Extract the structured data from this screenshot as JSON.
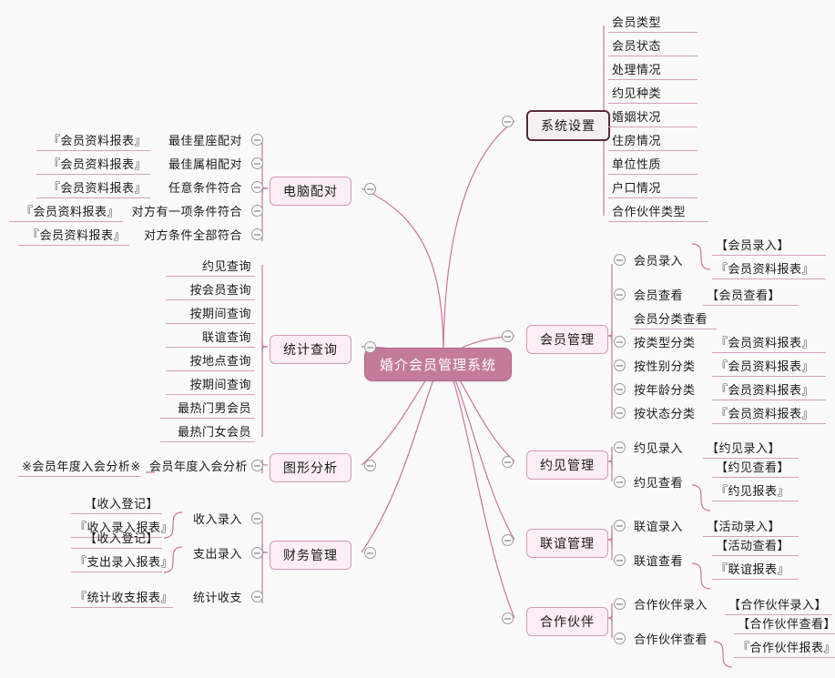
{
  "meta": {
    "title": "婚介会员管理系统",
    "colors": {
      "background": "#fafafa",
      "root_fill": "#c47a9b",
      "root_text": "#ffffff",
      "branch_fill": "#fbeef4",
      "branch_border": "#d49ab8",
      "selected_border": "#5b2639",
      "link": "#c9749b",
      "underline": "#d6a0bd",
      "toggle_stroke": "#9a9a9a"
    },
    "toggle_icon": "collapse-minus-circle-icon"
  },
  "root": {
    "label": "婚介会员管理系统"
  },
  "branches": {
    "system_settings": {
      "label": "系统设置",
      "selected": true,
      "items": [
        "会员类型",
        "会员状态",
        "处理情况",
        "约见种类",
        "婚姻状况",
        "住房情况",
        "单位性质",
        "户口情况",
        "合作伙伴类型"
      ]
    },
    "member_management": {
      "label": "会员管理",
      "items": [
        {
          "label": "会员录入",
          "children": [
            "【会员录入】",
            "『会员资料报表』"
          ]
        },
        {
          "label": "会员查看",
          "children": [
            "【会员查看】"
          ]
        },
        {
          "label": "会员分类查看",
          "children": []
        },
        {
          "label": "按类型分类",
          "children": [
            "『会员资料报表』"
          ]
        },
        {
          "label": "按性别分类",
          "children": [
            "『会员资料报表』"
          ]
        },
        {
          "label": "按年龄分类",
          "children": [
            "『会员资料报表』"
          ]
        },
        {
          "label": "按状态分类",
          "children": [
            "『会员资料报表』"
          ]
        }
      ]
    },
    "appointment_management": {
      "label": "约见管理",
      "items": [
        {
          "label": "约见录入",
          "children": [
            "【约见录入】"
          ]
        },
        {
          "label": "约见查看",
          "children": [
            "【约见查看】",
            "『约见报表』"
          ]
        }
      ]
    },
    "social_management": {
      "label": "联谊管理",
      "items": [
        {
          "label": "联谊录入",
          "children": [
            "【活动录入】"
          ]
        },
        {
          "label": "联谊查看",
          "children": [
            "【活动查看】",
            "『联谊报表』"
          ]
        }
      ]
    },
    "partner_management": {
      "label": "合作伙伴",
      "items": [
        {
          "label": "合作伙伴录入",
          "children": [
            "【合作伙伴录入】"
          ]
        },
        {
          "label": "合作伙伴查看",
          "children": [
            "【合作伙伴查看】",
            "『合作伙伴报表』"
          ]
        }
      ]
    },
    "computer_matching": {
      "label": "电脑配对",
      "items": [
        {
          "label": "最佳星座配对",
          "children": [
            "『会员资料报表』"
          ]
        },
        {
          "label": "最佳属相配对",
          "children": [
            "『会员资料报表』"
          ]
        },
        {
          "label": "任意条件符合",
          "children": [
            "『会员资料报表』"
          ]
        },
        {
          "label": "对方有一项条件符合",
          "children": [
            "『会员资料报表』"
          ]
        },
        {
          "label": "对方条件全部符合",
          "children": [
            "『会员资料报表』"
          ]
        }
      ]
    },
    "statistics_query": {
      "label": "统计查询",
      "items": [
        "约见查询",
        "按会员查询",
        "按期间查询",
        "联谊查询",
        "按地点查询",
        "按期间查询",
        "最热门男会员",
        "最热门女会员"
      ]
    },
    "graphic_analysis": {
      "label": "图形分析",
      "items": [
        {
          "label": "会员年度入会分析",
          "children": [
            "※会员年度入会分析※"
          ]
        }
      ]
    },
    "finance_management": {
      "label": "财务管理",
      "items": [
        {
          "label": "收入录入",
          "children": [
            "【收入登记】",
            "『收入录入报表』"
          ]
        },
        {
          "label": "支出录入",
          "children": [
            "【收入登记】",
            "『支出录入报表』"
          ]
        },
        {
          "label": "统计收支",
          "children": [
            "『统计收支报表』"
          ]
        }
      ]
    }
  }
}
